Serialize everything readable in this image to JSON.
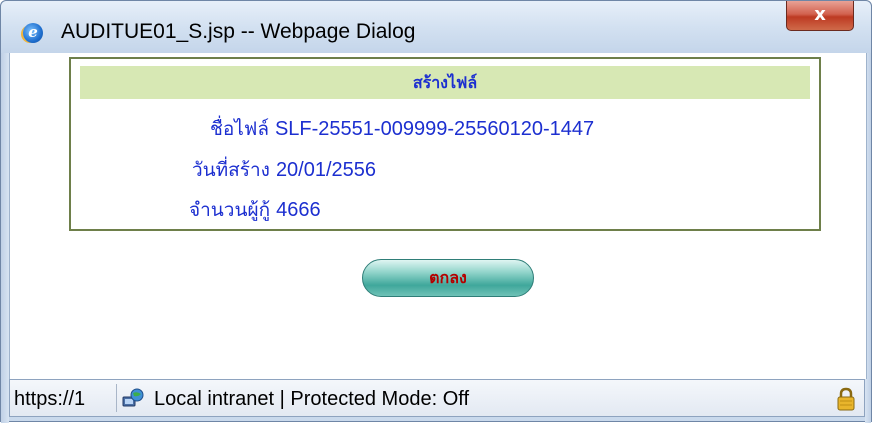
{
  "window": {
    "title": "AUDITUE01_S.jsp -- Webpage Dialog",
    "close_glyph": "x"
  },
  "panel": {
    "header": "สร้างไฟล์",
    "file_name_label": "ชื่อไฟล์",
    "file_name_value": "SLF-25551-009999-25560120-1447",
    "created_date_label": "วันที่สร้าง",
    "created_date_value": "20/01/2556",
    "borrower_count_label": "จำนวนผู้กู้",
    "borrower_count_value": "4666"
  },
  "ok_button": {
    "label": "ตกลง"
  },
  "statusbar": {
    "url": "https://1",
    "zone": "Local intranet | Protected Mode: Off",
    "zone_icon": "globe-network-icon",
    "lock_icon": "padlock-icon"
  },
  "colors": {
    "header_bg": "#d7e8b4",
    "text_blue": "#1c2fd0",
    "ok_text": "#b40000",
    "ok_button": "#3fa79b",
    "panel_border": "#6e7f4a"
  }
}
